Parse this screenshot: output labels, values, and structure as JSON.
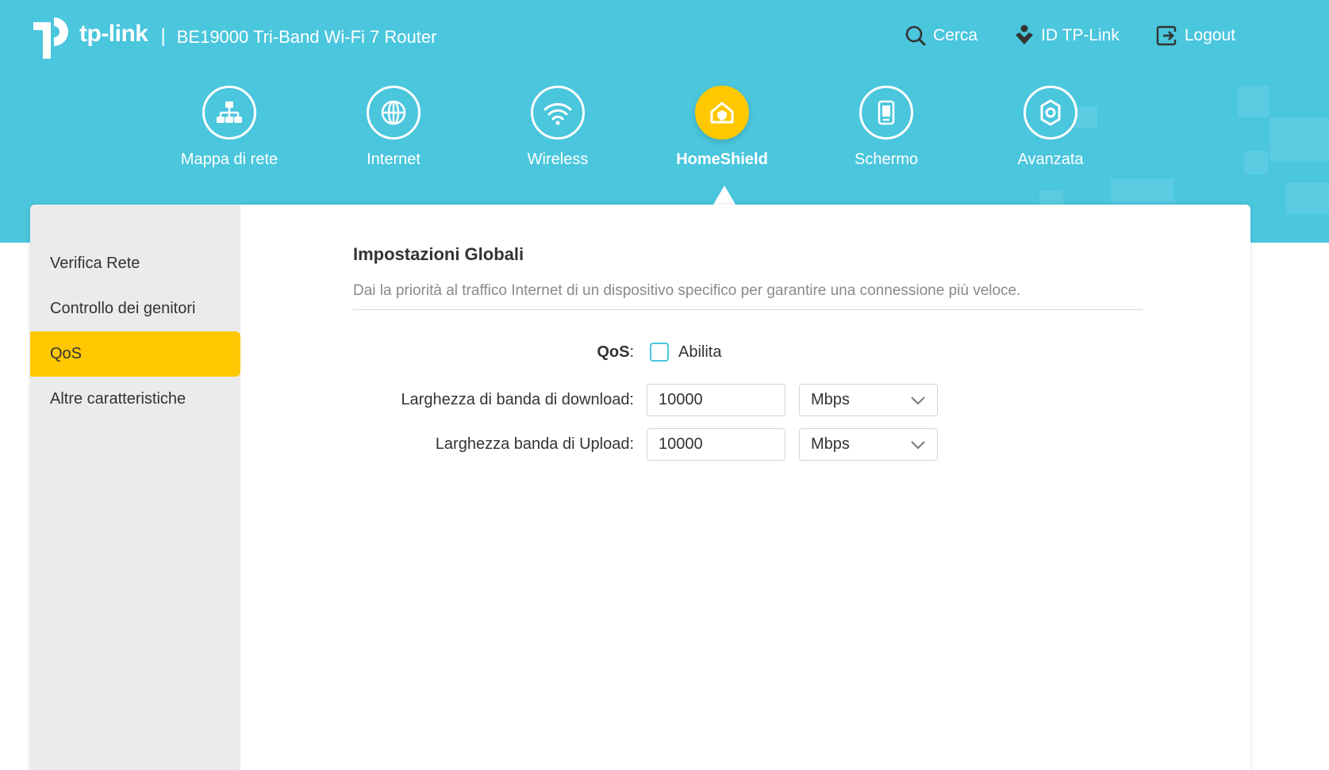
{
  "header": {
    "brand": "tp-link",
    "separator": "|",
    "model": "BE19000 Tri-Band Wi-Fi 7 Router",
    "actions": [
      {
        "label": "Cerca",
        "icon": "search-icon"
      },
      {
        "label": "ID TP-Link",
        "icon": "tp-link-id-icon"
      },
      {
        "label": "Logout",
        "icon": "logout-icon"
      }
    ]
  },
  "nav": {
    "items": [
      {
        "label": "Mappa di rete",
        "icon": "network-map-icon"
      },
      {
        "label": "Internet",
        "icon": "globe-icon"
      },
      {
        "label": "Wireless",
        "icon": "wifi-icon"
      },
      {
        "label": "HomeShield",
        "icon": "homeshield-icon"
      },
      {
        "label": "Schermo",
        "icon": "screen-icon"
      },
      {
        "label": "Avanzata",
        "icon": "gear-icon"
      }
    ],
    "active": "HomeShield"
  },
  "sidebar": {
    "items": [
      {
        "label": "Verifica Rete"
      },
      {
        "label": "Controllo dei genitori"
      },
      {
        "label": "QoS"
      },
      {
        "label": "Altre caratteristiche"
      }
    ],
    "active": "QoS"
  },
  "content": {
    "title": "Impostazioni Globali",
    "description": "Dai la priorità al traffico Internet di un dispositivo specifico per garantire una connessione più veloce.",
    "qos": {
      "label": "QoS",
      "colon": ":",
      "checkbox_label": "Abilita",
      "checked": false
    },
    "download": {
      "label": "Larghezza di banda di download:",
      "value": "10000",
      "unit": "Mbps"
    },
    "upload": {
      "label": "Larghezza banda di Upload:",
      "value": "10000",
      "unit": "Mbps"
    }
  },
  "colors": {
    "header_bg": "#4ac6dd",
    "accent": "#ffc800",
    "sidebar_bg": "#ebebed"
  }
}
